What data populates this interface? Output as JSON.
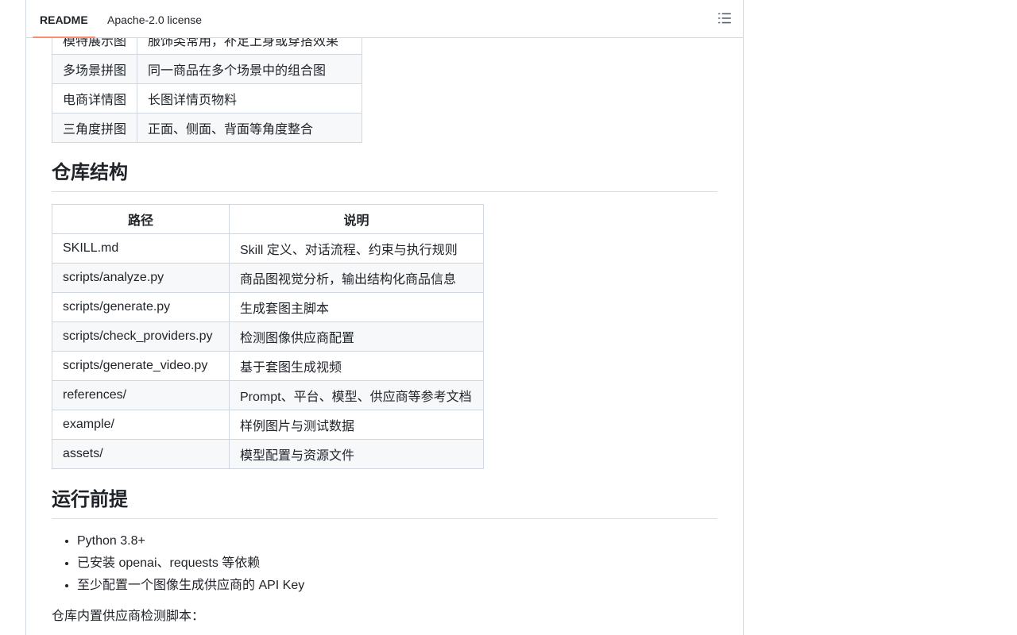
{
  "tabs": {
    "readme": "README",
    "license": "Apache-2.0 license",
    "toc_icon": "list-unordered-icon"
  },
  "image_types_table": {
    "rows": [
      [
        "模特展示图",
        "服饰类常用，补足上身或穿搭效果"
      ],
      [
        "多场景拼图",
        "同一商品在多个场景中的组合图"
      ],
      [
        "电商详情图",
        "长图详情页物料"
      ],
      [
        "三角度拼图",
        "正面、侧面、背面等角度整合"
      ]
    ]
  },
  "repo_structure": {
    "heading": "仓库结构",
    "headers": [
      "路径",
      "说明"
    ],
    "rows": [
      [
        "SKILL.md",
        "Skill 定义、对话流程、约束与执行规则"
      ],
      [
        "scripts/analyze.py",
        "商品图视觉分析，输出结构化商品信息"
      ],
      [
        "scripts/generate.py",
        "生成套图主脚本"
      ],
      [
        "scripts/check_providers.py",
        "检测图像供应商配置"
      ],
      [
        "scripts/generate_video.py",
        "基于套图生成视频"
      ],
      [
        "references/",
        "Prompt、平台、模型、供应商等参考文档"
      ],
      [
        "example/",
        "样例图片与测试数据"
      ],
      [
        "assets/",
        "模型配置与资源文件"
      ]
    ]
  },
  "prerequisites": {
    "heading": "运行前提",
    "items": [
      "Python 3.8+",
      "已安装 openai、requests 等依赖",
      "至少配置一个图像生成供应商的 API Key"
    ],
    "note": "仓库内置供应商检测脚本："
  }
}
